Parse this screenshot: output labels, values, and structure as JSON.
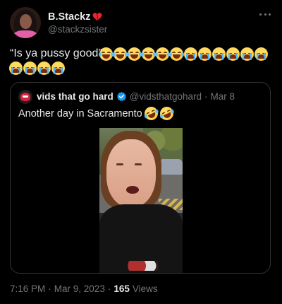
{
  "author": {
    "display_name": "B.Stackz",
    "handle": "@stackzsister",
    "badge_icon": "broken-heart-icon"
  },
  "tweet": {
    "text": "“Is ya pussy good”",
    "emojis_line1": [
      "face-with-tears-of-joy",
      "face-with-tears-of-joy",
      "face-with-tears-of-joy",
      "face-with-tears-of-joy",
      "face-with-tears-of-joy",
      "face-with-tears-of-joy",
      "loudly-crying-face",
      "loudly-crying-face",
      "loudly-crying-face",
      "loudly-crying-face",
      "loudly-crying-face",
      "loudly-crying-face"
    ],
    "emojis_line2": [
      "loudly-crying-face",
      "loudly-crying-face",
      "loudly-crying-face",
      "loudly-crying-face"
    ]
  },
  "quote": {
    "display_name": "vids that go hard",
    "handle": "@vidsthatgohard",
    "separator": "·",
    "date": "Mar 8",
    "text": "Another day in Sacramento",
    "emojis": [
      "rolling-on-the-floor-laughing",
      "rolling-on-the-floor-laughing"
    ],
    "verified_color": "#1d9bf0"
  },
  "meta": {
    "time": "7:16 PM",
    "separator": "·",
    "date": "Mar 9, 2023",
    "views_count": "165",
    "views_label": "Views"
  },
  "colors": {
    "background": "#000000",
    "text_primary": "#e7e9ea",
    "text_secondary": "#71767b",
    "border": "#2f3336",
    "heart": "#f4212e"
  }
}
